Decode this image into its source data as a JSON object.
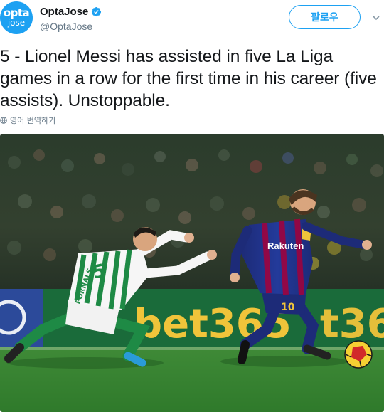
{
  "user": {
    "avatar_line1": "opta",
    "avatar_line2": "jose",
    "display_name": "OptaJose",
    "handle": "@OptaJose"
  },
  "follow_label": "팔로우",
  "tweet": {
    "text": "5 - Lionel Messi has assisted in five La Liga games in a row for the first time in his career (five assists). Unstoppable."
  },
  "translate_label": "영어 번역하기",
  "photo": {
    "sponsor_text": "bet365",
    "shirt_brand": "Rakuten",
    "shirt_number": "10",
    "left_player_number": "5",
    "left_player_name": "FORNALS"
  },
  "icons": [
    "opta-avatar-icon",
    "verified-badge-icon",
    "chevron-down-icon",
    "globe-icon"
  ],
  "colors": {
    "accent": "#1da1f2",
    "text": "#14171a",
    "muted": "#657786",
    "barca_blue": "#1d2b78",
    "barca_red": "#a5003a",
    "betis_green": "#1e8a45"
  }
}
